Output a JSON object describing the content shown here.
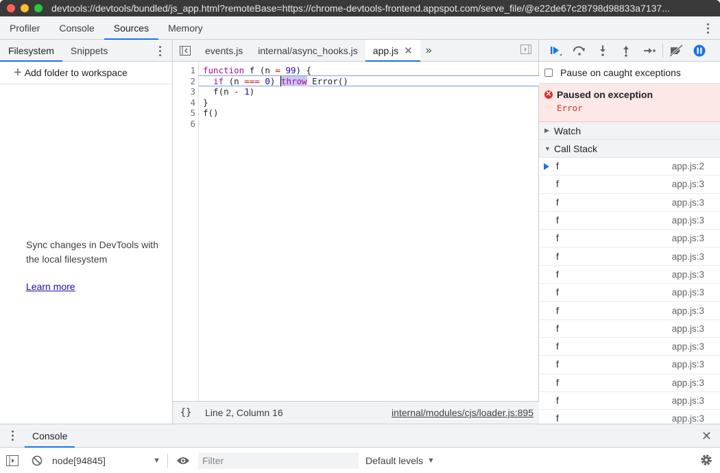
{
  "window": {
    "title": "devtools://devtools/bundled/js_app.html?remoteBase=https://chrome-devtools-frontend.appspot.com/serve_file/@e22de67c28798d98833a7137..."
  },
  "main_tabs": [
    {
      "label": "Profiler"
    },
    {
      "label": "Console"
    },
    {
      "label": "Sources",
      "active": true
    },
    {
      "label": "Memory"
    }
  ],
  "navigator": {
    "tabs": [
      {
        "label": "Filesystem",
        "active": true
      },
      {
        "label": "Snippets"
      }
    ],
    "add_folder_label": "Add folder to workspace",
    "sync_text": "Sync changes in DevTools with the local filesystem",
    "learn_more_label": "Learn more"
  },
  "editor": {
    "tabs": [
      {
        "label": "events.js"
      },
      {
        "label": "internal/async_hooks.js"
      },
      {
        "label": "app.js",
        "active": true
      }
    ],
    "more_tabs_glyph": "»",
    "close_glyph": "✕",
    "line_numbers": [
      "1",
      "2",
      "3",
      "4",
      "5",
      "6"
    ],
    "code": {
      "l1_kw": "function",
      "l1_rest_a": " f (n ",
      "l1_eq": "=",
      "l1_sp": " ",
      "l1_num": "99",
      "l1_rest_b": ") {",
      "l2_indent": "  ",
      "l2_kw": "if",
      "l2_rest_a": " (n ",
      "l2_op": "===",
      "l2_sp": " ",
      "l2_num": "0",
      "l2_rest_b": ") ",
      "l2_throw": "throw",
      "l2_rest_c": " Error()",
      "l3_a": "  f(n ",
      "l3_op": "-",
      "l3_sp": " ",
      "l3_num": "1",
      "l3_b": ")",
      "l4": "}",
      "l5": "f()"
    },
    "status": {
      "pretty_print_glyph": "{}",
      "cursor_position": "Line 2, Column 16",
      "source_link": "internal/modules/cjs/loader.js:895"
    }
  },
  "debugger": {
    "pause_on_caught_label": "Pause on caught exceptions",
    "exception": {
      "title": "Paused on exception",
      "message": "Error"
    },
    "watch_label": "Watch",
    "call_stack_label": "Call Stack",
    "call_stack": [
      {
        "name": "f",
        "location": "app.js:2",
        "current": true
      },
      {
        "name": "f",
        "location": "app.js:3"
      },
      {
        "name": "f",
        "location": "app.js:3"
      },
      {
        "name": "f",
        "location": "app.js:3"
      },
      {
        "name": "f",
        "location": "app.js:3"
      },
      {
        "name": "f",
        "location": "app.js:3"
      },
      {
        "name": "f",
        "location": "app.js:3"
      },
      {
        "name": "f",
        "location": "app.js:3"
      },
      {
        "name": "f",
        "location": "app.js:3"
      },
      {
        "name": "f",
        "location": "app.js:3"
      },
      {
        "name": "f",
        "location": "app.js:3"
      },
      {
        "name": "f",
        "location": "app.js:3"
      },
      {
        "name": "f",
        "location": "app.js:3"
      },
      {
        "name": "f",
        "location": "app.js:3"
      },
      {
        "name": "f",
        "location": "app.js:3"
      }
    ]
  },
  "drawer": {
    "tab_label": "Console",
    "close_glyph": "✕",
    "context": "node[94845]",
    "filter_placeholder": "Filter",
    "levels_label": "Default levels"
  },
  "colors": {
    "accent": "#1a73e8",
    "error": "#d93025",
    "exception_bg": "#fce8e6"
  }
}
